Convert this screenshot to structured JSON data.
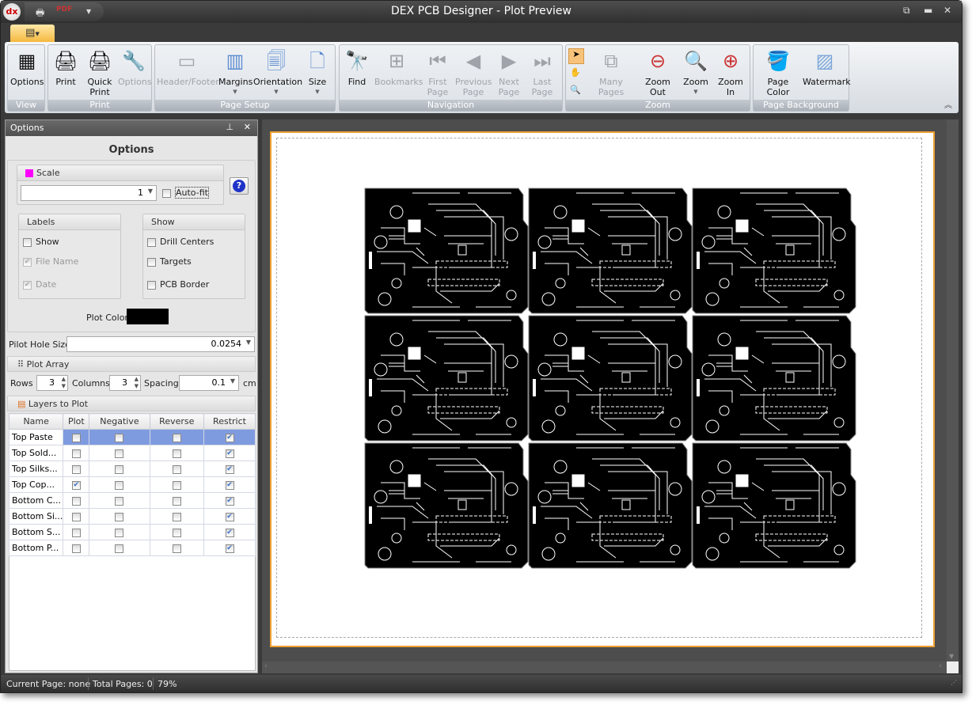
{
  "window": {
    "title": "DEX PCB Designer - Plot Preview",
    "app_icon": "dex-logo-icon",
    "qat": [
      "print-icon",
      "pdf-save-icon",
      "customize-dropdown-icon"
    ],
    "controls": [
      "restore-icon",
      "maximize-icon",
      "close-icon"
    ]
  },
  "ribbon": {
    "groups": [
      {
        "label": "View",
        "buttons": [
          {
            "label": "Options",
            "enabled": true
          }
        ]
      },
      {
        "label": "Print",
        "buttons": [
          {
            "label": "Print",
            "enabled": true
          },
          {
            "label": "Quick Print",
            "enabled": true
          },
          {
            "label": "Options",
            "enabled": false
          }
        ]
      },
      {
        "label": "Page Setup",
        "buttons": [
          {
            "label": "Header/Footer",
            "enabled": false
          },
          {
            "label": "Margins",
            "enabled": true
          },
          {
            "label": "Orientation",
            "enabled": true
          },
          {
            "label": "Size",
            "enabled": true
          }
        ]
      },
      {
        "label": "Navigation",
        "buttons": [
          {
            "label": "Find",
            "enabled": true
          },
          {
            "label": "Bookmarks",
            "enabled": false
          },
          {
            "label": "First Page",
            "enabled": false
          },
          {
            "label": "Previous Page",
            "enabled": false
          },
          {
            "label": "Next Page",
            "enabled": false
          },
          {
            "label": "Last Page",
            "enabled": false
          }
        ]
      },
      {
        "label": "Zoom",
        "buttons": [
          {
            "label": "Many Pages",
            "enabled": false
          },
          {
            "label": "Zoom Out",
            "enabled": true
          },
          {
            "label": "Zoom",
            "enabled": true
          },
          {
            "label": "Zoom In",
            "enabled": true
          }
        ]
      },
      {
        "label": "Page Background",
        "buttons": [
          {
            "label": "Page Color",
            "enabled": true
          },
          {
            "label": "Watermark",
            "enabled": true
          }
        ]
      }
    ]
  },
  "panel": {
    "header": "Options",
    "title": "Options",
    "scale": {
      "label": "Scale",
      "value": "1",
      "autofit_label": "Auto-fit",
      "autofit": false
    },
    "labels": {
      "title": "Labels",
      "show": "Show",
      "file_name": "File Name",
      "date": "Date",
      "show_checked": false,
      "file_name_checked": true,
      "date_checked": true
    },
    "show": {
      "title": "Show",
      "drill_centers": "Drill Centers",
      "targets": "Targets",
      "pcb_border": "PCB Border"
    },
    "plot_color_label": "Plot Color",
    "plot_color": "#000000",
    "pilot_hole_label": "Pilot Hole Size",
    "pilot_hole_value": "0.0254",
    "plot_array": {
      "title": "Plot Array",
      "rows_label": "Rows",
      "rows": "3",
      "columns_label": "Columns",
      "columns": "3",
      "spacing_label": "Spacing",
      "spacing": "0.1",
      "unit": "cm"
    },
    "layers": {
      "title": "Layers to Plot",
      "columns": [
        "Name",
        "Plot",
        "Negative",
        "Reverse",
        "Restrict"
      ],
      "rows": [
        {
          "name": "Top Paste",
          "plot": false,
          "negative": false,
          "reverse": false,
          "restrict": true,
          "selected": true
        },
        {
          "name": "Top Sold...",
          "plot": false,
          "negative": false,
          "reverse": false,
          "restrict": true
        },
        {
          "name": "Top Silks...",
          "plot": false,
          "negative": false,
          "reverse": false,
          "restrict": true
        },
        {
          "name": "Top Cop...",
          "plot": true,
          "negative": false,
          "reverse": false,
          "restrict": true
        },
        {
          "name": "Bottom C...",
          "plot": false,
          "negative": false,
          "reverse": false,
          "restrict": true
        },
        {
          "name": "Bottom Si...",
          "plot": false,
          "negative": false,
          "reverse": false,
          "restrict": true
        },
        {
          "name": "Bottom S...",
          "plot": false,
          "negative": false,
          "reverse": false,
          "restrict": true
        },
        {
          "name": "Bottom P...",
          "plot": false,
          "negative": false,
          "reverse": false,
          "restrict": true
        }
      ]
    }
  },
  "status": {
    "current_page": "Current Page: none",
    "total_pages": "Total Pages: 0",
    "zoom": "79%"
  },
  "colors": {
    "page_border": "#f0a030",
    "selection": "#7f9be0",
    "board": "#000000"
  }
}
